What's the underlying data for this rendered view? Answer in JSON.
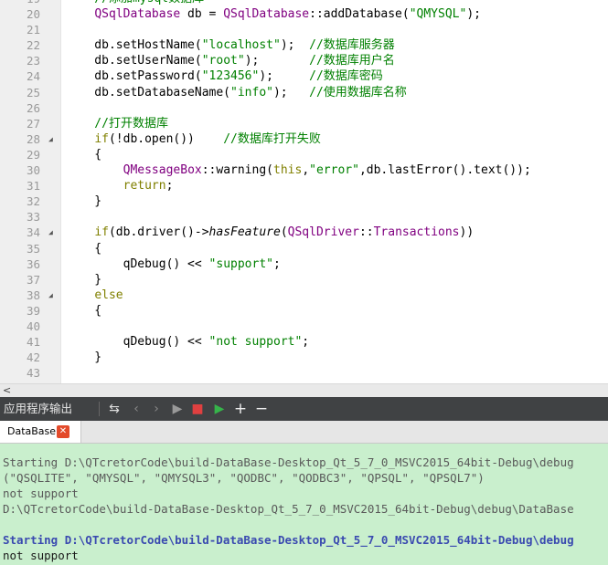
{
  "editor": {
    "lines": [
      {
        "n": "19",
        "fold": "",
        "segs": [
          {
            "t": "    //添加mysql数据库",
            "c": "c-comment"
          }
        ]
      },
      {
        "n": "20",
        "fold": "",
        "segs": [
          {
            "t": "    ",
            "c": ""
          },
          {
            "t": "QSqlDatabase",
            "c": "c-type"
          },
          {
            "t": " db = ",
            "c": ""
          },
          {
            "t": "QSqlDatabase",
            "c": "c-type"
          },
          {
            "t": "::addDatabase(",
            "c": ""
          },
          {
            "t": "\"QMYSQL\"",
            "c": "c-str"
          },
          {
            "t": ");",
            "c": ""
          }
        ]
      },
      {
        "n": "21",
        "fold": "",
        "segs": []
      },
      {
        "n": "22",
        "fold": "",
        "segs": [
          {
            "t": "    db.setHostName(",
            "c": ""
          },
          {
            "t": "\"localhost\"",
            "c": "c-str"
          },
          {
            "t": ");  ",
            "c": ""
          },
          {
            "t": "//数据库服务器",
            "c": "c-comment"
          }
        ]
      },
      {
        "n": "23",
        "fold": "",
        "segs": [
          {
            "t": "    db.setUserName(",
            "c": ""
          },
          {
            "t": "\"root\"",
            "c": "c-str"
          },
          {
            "t": ");       ",
            "c": ""
          },
          {
            "t": "//数据库用户名",
            "c": "c-comment"
          }
        ]
      },
      {
        "n": "24",
        "fold": "",
        "segs": [
          {
            "t": "    db.setPassword(",
            "c": ""
          },
          {
            "t": "\"123456\"",
            "c": "c-str"
          },
          {
            "t": ");     ",
            "c": ""
          },
          {
            "t": "//数据库密码",
            "c": "c-comment"
          }
        ]
      },
      {
        "n": "25",
        "fold": "",
        "segs": [
          {
            "t": "    db.setDatabaseName(",
            "c": ""
          },
          {
            "t": "\"info\"",
            "c": "c-str"
          },
          {
            "t": ");   ",
            "c": ""
          },
          {
            "t": "//使用数据库名称",
            "c": "c-comment"
          }
        ]
      },
      {
        "n": "26",
        "fold": "",
        "segs": []
      },
      {
        "n": "27",
        "fold": "",
        "segs": [
          {
            "t": "    //打开数据库",
            "c": "c-comment"
          }
        ]
      },
      {
        "n": "28",
        "fold": "◢",
        "segs": [
          {
            "t": "    ",
            "c": ""
          },
          {
            "t": "if",
            "c": "c-kw"
          },
          {
            "t": "(!db.open())    ",
            "c": ""
          },
          {
            "t": "//数据库打开失败",
            "c": "c-comment"
          }
        ]
      },
      {
        "n": "29",
        "fold": "",
        "segs": [
          {
            "t": "    {",
            "c": ""
          }
        ]
      },
      {
        "n": "30",
        "fold": "",
        "segs": [
          {
            "t": "        ",
            "c": ""
          },
          {
            "t": "QMessageBox",
            "c": "c-type"
          },
          {
            "t": "::warning(",
            "c": ""
          },
          {
            "t": "this",
            "c": "c-kw"
          },
          {
            "t": ",",
            "c": ""
          },
          {
            "t": "\"error\"",
            "c": "c-str"
          },
          {
            "t": ",db.lastError().text());",
            "c": ""
          }
        ]
      },
      {
        "n": "31",
        "fold": "",
        "segs": [
          {
            "t": "        ",
            "c": ""
          },
          {
            "t": "return",
            "c": "c-kw"
          },
          {
            "t": ";",
            "c": ""
          }
        ]
      },
      {
        "n": "32",
        "fold": "",
        "segs": [
          {
            "t": "    }",
            "c": ""
          }
        ]
      },
      {
        "n": "33",
        "fold": "",
        "segs": []
      },
      {
        "n": "34",
        "fold": "◢",
        "segs": [
          {
            "t": "    ",
            "c": ""
          },
          {
            "t": "if",
            "c": "c-kw"
          },
          {
            "t": "(db.driver()->",
            "c": ""
          },
          {
            "t": "hasFeature",
            "c": "c-italic"
          },
          {
            "t": "(",
            "c": ""
          },
          {
            "t": "QSqlDriver",
            "c": "c-type"
          },
          {
            "t": "::",
            "c": ""
          },
          {
            "t": "Transactions",
            "c": "c-type"
          },
          {
            "t": "))",
            "c": ""
          }
        ]
      },
      {
        "n": "35",
        "fold": "",
        "segs": [
          {
            "t": "    {",
            "c": ""
          }
        ]
      },
      {
        "n": "36",
        "fold": "",
        "segs": [
          {
            "t": "        qDebug() << ",
            "c": ""
          },
          {
            "t": "\"support\"",
            "c": "c-str"
          },
          {
            "t": ";",
            "c": ""
          }
        ]
      },
      {
        "n": "37",
        "fold": "",
        "segs": [
          {
            "t": "    }",
            "c": ""
          }
        ]
      },
      {
        "n": "38",
        "fold": "◢",
        "segs": [
          {
            "t": "    ",
            "c": ""
          },
          {
            "t": "else",
            "c": "c-kw"
          }
        ]
      },
      {
        "n": "39",
        "fold": "",
        "segs": [
          {
            "t": "    {",
            "c": ""
          }
        ]
      },
      {
        "n": "40",
        "fold": "",
        "segs": []
      },
      {
        "n": "41",
        "fold": "",
        "segs": [
          {
            "t": "        qDebug() << ",
            "c": ""
          },
          {
            "t": "\"not support\"",
            "c": "c-str"
          },
          {
            "t": ";",
            "c": ""
          }
        ]
      },
      {
        "n": "42",
        "fold": "",
        "segs": [
          {
            "t": "    }",
            "c": ""
          }
        ]
      },
      {
        "n": "43",
        "fold": "",
        "segs": []
      }
    ]
  },
  "hscroll": {
    "arrow": "<"
  },
  "panel": {
    "title": "应用程序输出",
    "toolbar_glyphs": [
      "⇆",
      "‹",
      "›",
      "▶",
      "■",
      "▶",
      "+",
      "−"
    ],
    "tab_label": "DataBase",
    "tab_close": "✕"
  },
  "output": {
    "lines": [
      {
        "t": "Starting D:\\QTcretorCode\\build-DataBase-Desktop_Qt_5_7_0_MSVC2015_64bit-Debug\\debug",
        "c": "o-grey"
      },
      {
        "t": "(\"QSQLITE\", \"QMYSQL\", \"QMYSQL3\", \"QODBC\", \"QODBC3\", \"QPSQL\", \"QPSQL7\")",
        "c": "o-grey"
      },
      {
        "t": "not support",
        "c": "o-grey"
      },
      {
        "t": "D:\\QTcretorCode\\build-DataBase-Desktop_Qt_5_7_0_MSVC2015_64bit-Debug\\debug\\DataBase",
        "c": "o-grey"
      },
      {
        "t": "",
        "c": "o-grey"
      },
      {
        "t": "Starting D:\\QTcretorCode\\build-DataBase-Desktop_Qt_5_7_0_MSVC2015_64bit-Debug\\debug",
        "c": "o-blue"
      },
      {
        "t": "not support",
        "c": "o-dark"
      }
    ]
  },
  "colors": {
    "toolbar_red": "#e04040",
    "toolbar_green": "#36b44a",
    "output_bg": "#c9efcd"
  }
}
